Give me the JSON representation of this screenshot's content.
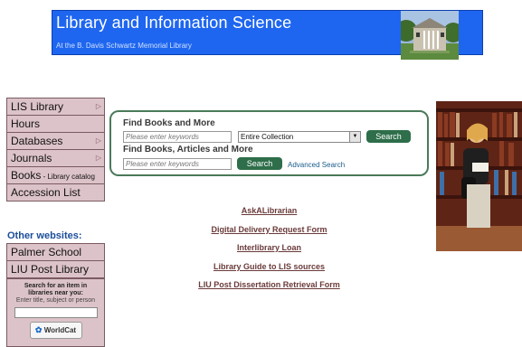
{
  "header": {
    "title": "Library and Information Science",
    "subtitle": "At the B. Davis Schwartz Memorial Library"
  },
  "nav": {
    "items": [
      {
        "label": "LIS Library",
        "sub": "",
        "has_arrow": true
      },
      {
        "label": "Hours",
        "sub": "",
        "has_arrow": false
      },
      {
        "label": "Databases",
        "sub": "",
        "has_arrow": true
      },
      {
        "label": "Journals",
        "sub": "",
        "has_arrow": true
      },
      {
        "label": "Books",
        "sub": " - Library catalog",
        "has_arrow": false
      },
      {
        "label": "Accession List",
        "sub": "",
        "has_arrow": false
      }
    ],
    "arrow_glyph": "▷"
  },
  "other_sites": {
    "heading": "Other websites:",
    "items": [
      "Palmer School",
      "LIU Post Library"
    ]
  },
  "worldcat": {
    "line1": "Search for an item in",
    "line1b": "libraries near you:",
    "line2": "Enter title, subject or person",
    "button_label": "WorldCat"
  },
  "search": {
    "books_heading": "Find Books and More",
    "books_placeholder": "Please enter keywords",
    "collection_selected": "Entire Collection",
    "search_label": "Search",
    "articles_heading": "Find Books, Articles and More",
    "articles_placeholder": "Please enter keywords",
    "advanced_label": "Advanced Search"
  },
  "links": [
    "AskALibrarian",
    "Digital Delivery Request Form",
    "Interlibrary Loan",
    "Library Guide to LIS sources",
    "LIU Post Dissertation Retrieval Form"
  ],
  "colors": {
    "banner": "#1e66f0",
    "nav_bg": "#dcc3c9",
    "search_button": "#2e6e4a",
    "link": "#6b3a3a",
    "heading_blue": "#1a4d99"
  }
}
